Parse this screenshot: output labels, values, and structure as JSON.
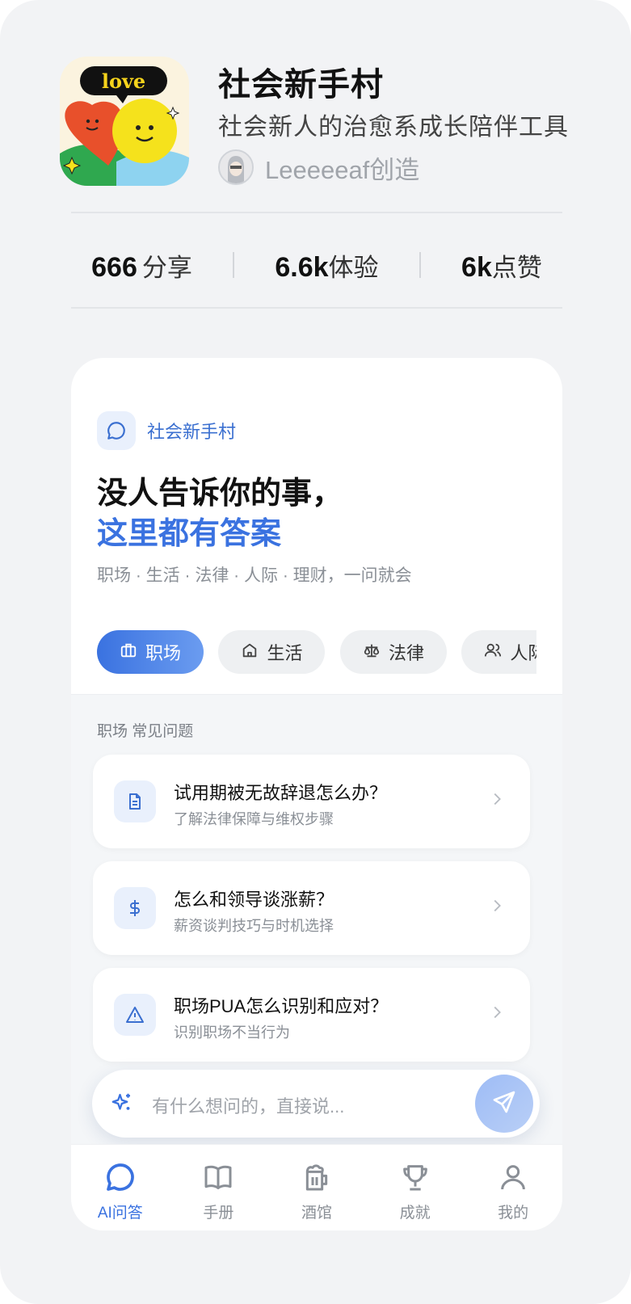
{
  "app": {
    "title": "社会新手村",
    "subtitle": "社会新人的治愈系成长陪伴工具",
    "creator": "Leeeeeaf创造",
    "icon_text": "love"
  },
  "stats": [
    {
      "value": "666",
      "label": "分享"
    },
    {
      "value": "6.6k",
      "label": "体验"
    },
    {
      "value": "6k",
      "label": "点赞"
    }
  ],
  "card": {
    "badge": "社会新手村",
    "headline_line1": "没人告诉你的事，",
    "headline_line2": "这里都有答案",
    "tagline": "职场 · 生活 · 法律 · 人际 · 理财，一问就会",
    "chips": [
      {
        "label": "职场",
        "icon": "briefcase-icon",
        "active": true
      },
      {
        "label": "生活",
        "icon": "home-icon",
        "active": false
      },
      {
        "label": "法律",
        "icon": "scale-icon",
        "active": false
      },
      {
        "label": "人际",
        "icon": "users-icon",
        "active": false
      }
    ],
    "section_label": "职场 常见问题",
    "questions": [
      {
        "title": "试用期被无故辞退怎么办？",
        "subtitle": "了解法律保障与维权步骤",
        "icon": "document-icon"
      },
      {
        "title": "怎么和领导谈涨薪？",
        "subtitle": "薪资谈判技巧与时机选择",
        "icon": "dollar-icon"
      },
      {
        "title": "职场PUA怎么识别和应对？",
        "subtitle": "识别职场不当行为",
        "icon": "warning-icon"
      }
    ]
  },
  "ask": {
    "placeholder": "有什么想问的，直接说..."
  },
  "tabs": [
    {
      "label": "AI问答",
      "icon": "chat-bubble-icon",
      "active": true
    },
    {
      "label": "手册",
      "icon": "book-icon",
      "active": false
    },
    {
      "label": "酒馆",
      "icon": "beer-mug-icon",
      "active": false
    },
    {
      "label": "成就",
      "icon": "trophy-icon",
      "active": false
    },
    {
      "label": "我的",
      "icon": "user-icon",
      "active": false
    }
  ],
  "colors": {
    "accent": "#3a72e0",
    "accent_light": "#e9f0fc",
    "page_bg": "#f2f3f5"
  }
}
